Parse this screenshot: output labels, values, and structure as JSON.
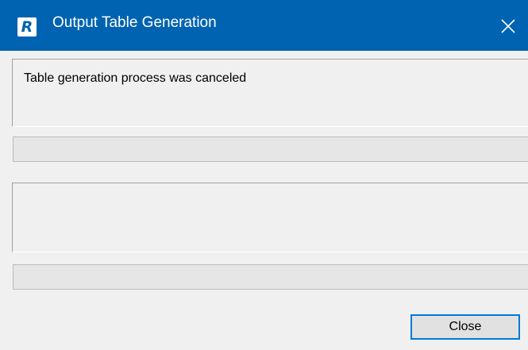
{
  "window": {
    "title": "Output Table Generation",
    "app_icon": "R-logo-icon",
    "close_icon": "close-icon",
    "accent_color": "#0063b1"
  },
  "message": {
    "text": "Table generation process was canceled"
  },
  "progress_bars": [
    {
      "progress": 0
    },
    {
      "progress": 0
    }
  ],
  "details": {
    "text": ""
  },
  "footer": {
    "close_label": "Close"
  }
}
